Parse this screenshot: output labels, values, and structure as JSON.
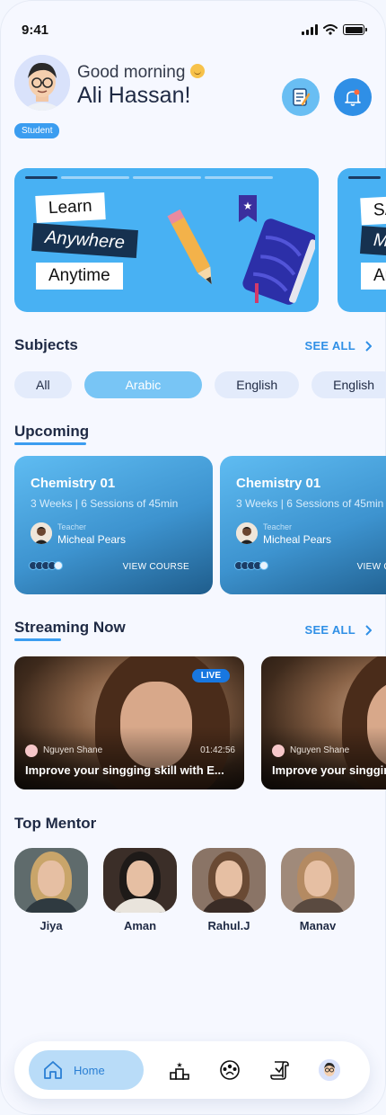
{
  "status_bar": {
    "time": "9:41"
  },
  "header": {
    "greeting": "Good morning",
    "user_name": "Ali Hassan!",
    "role": "Student"
  },
  "banner": {
    "words": [
      "Learn",
      "Anywhere",
      "Anytime"
    ],
    "peek_words": [
      "SA",
      "Me",
      "An"
    ]
  },
  "subjects": {
    "title": "Subjects",
    "see_all": "SEE ALL",
    "chips": [
      "All",
      "Arabic",
      "English",
      "English"
    ],
    "selected": "Arabic"
  },
  "upcoming": {
    "title": "Upcoming",
    "courses": [
      {
        "title": "Chemistry 01",
        "schedule": "3 Weeks | 6 Sessions of 45min",
        "teacher_label": "Teacher",
        "teacher": "Micheal Pears",
        "cta": "VIEW COURSE"
      },
      {
        "title": "Chemistry 01",
        "schedule": "3 Weeks | 6 Sessions of 45min",
        "teacher_label": "Teacher",
        "teacher": "Micheal Pears",
        "cta": "VIEW COURSE"
      }
    ]
  },
  "streaming": {
    "title": "Streaming Now",
    "see_all": "SEE ALL",
    "items": [
      {
        "badge": "LIVE",
        "host": "Nguyen Shane",
        "duration": "01:42:56",
        "title": "Improve your singging skill with E..."
      },
      {
        "host": "Nguyen Shane",
        "title": "Improve your singging skill with E..."
      }
    ]
  },
  "mentors": {
    "title": "Top Mentor",
    "items": [
      "Jiya",
      "Aman",
      "Rahul.J",
      "Manav"
    ]
  },
  "bottom_nav": {
    "home_label": "Home",
    "icons": [
      "home-icon",
      "leaderboard-icon",
      "community-icon",
      "certificate-icon",
      "profile-avatar"
    ]
  },
  "colors": {
    "accent": "#2f8fe6",
    "banner": "#48b1f3",
    "dark": "#1f2a44"
  }
}
